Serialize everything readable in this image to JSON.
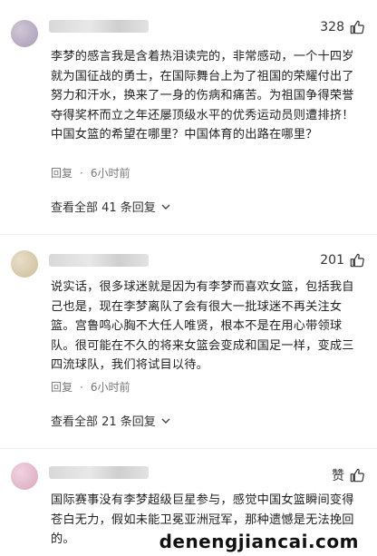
{
  "comments": [
    {
      "likes": "328",
      "text": "李梦的感言我是含着热泪读完的，非常感动，一个十四岁就为国征战的勇士，在国际舞台上为了祖国的荣耀付出了努力和汗水，换来了一身的伤病和痛苦。为祖国争得荣誉夺得奖杯而立之年还屡顶级水平的优秀运动员则遭排挤！中国女篮的希望在哪里？中国体育的出路在哪里？",
      "reply_label": "回复",
      "time": "6小时前",
      "expand_label": "查看全部 41 条回复"
    },
    {
      "likes": "201",
      "text": "说实话，很多球迷就是因为有李梦而喜欢女篮，包括我自己也是，现在李梦离队了会有很大一批球迷不再关注女篮。宫鲁鸣心胸不大任人唯贤，根本不是在用心带领球队。很可能在不久的将来女篮会变成和国足一样，变成三四流球队，我们将试目以待。",
      "reply_label": "回复",
      "time": "6小时前",
      "expand_label": "查看全部 21 条回复"
    },
    {
      "likes": "赞",
      "text": "国际赛事没有李梦超级巨星参与，感觉中国女篮瞬间变得苍白无力，假如未能卫冕亚洲冠军，那种遗憾是无法挽回的。"
    }
  ],
  "watermark": "denengjiancai.com",
  "icons": {
    "like": "thumbs-up-icon",
    "expand": "chevron-down-icon"
  }
}
